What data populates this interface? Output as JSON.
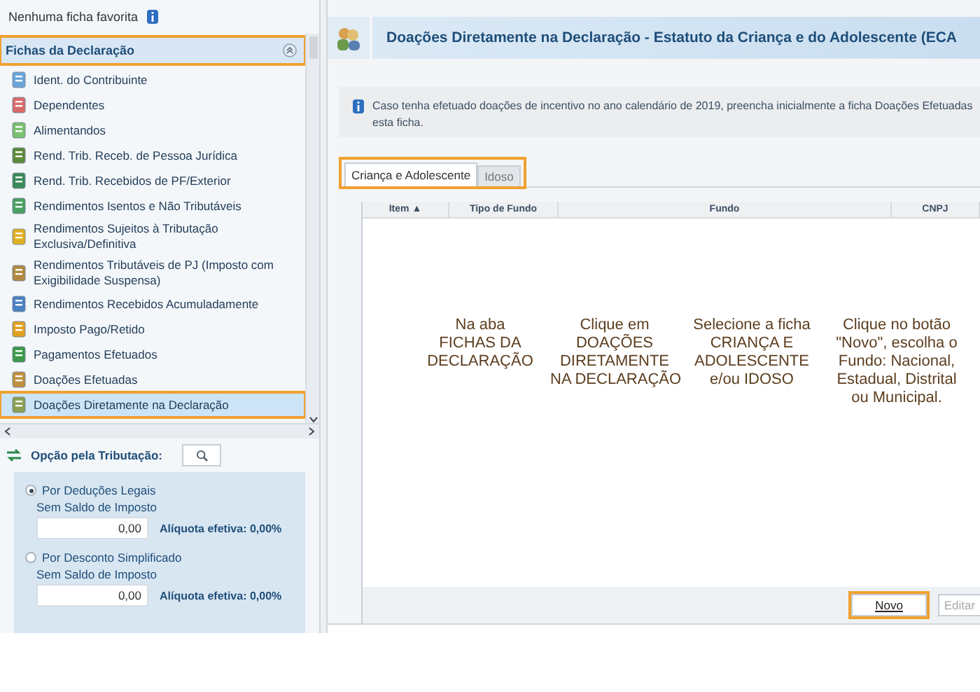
{
  "favorites": {
    "text": "Nenhuma ficha favorita"
  },
  "sidebar": {
    "section": {
      "title": "Fichas da Declaração",
      "expanded": true,
      "highlighted": true
    },
    "items": [
      {
        "label": "Ident. do Contribuinte",
        "selected": false,
        "highlighted": false
      },
      {
        "label": "Dependentes",
        "selected": false,
        "highlighted": false
      },
      {
        "label": "Alimentandos",
        "selected": false,
        "highlighted": false
      },
      {
        "label": "Rend. Trib. Receb. de Pessoa Jurídica",
        "selected": false,
        "highlighted": false
      },
      {
        "label": "Rend. Trib. Recebidos de PF/Exterior",
        "selected": false,
        "highlighted": false
      },
      {
        "label": "Rendimentos Isentos e Não Tributáveis",
        "selected": false,
        "highlighted": false
      },
      {
        "label": "Rendimentos Sujeitos à Tributação Exclusiva/Definitiva",
        "selected": false,
        "highlighted": false
      },
      {
        "label": "Rendimentos Tributáveis de PJ (Imposto com Exigibilidade Suspensa)",
        "selected": false,
        "highlighted": false
      },
      {
        "label": "Rendimentos Recebidos Acumuladamente",
        "selected": false,
        "highlighted": false
      },
      {
        "label": "Imposto Pago/Retido",
        "selected": false,
        "highlighted": false
      },
      {
        "label": "Pagamentos Efetuados",
        "selected": false,
        "highlighted": false
      },
      {
        "label": "Doações Efetuadas",
        "selected": false,
        "highlighted": false
      },
      {
        "label": "Doações Diretamente na Declaração",
        "selected": true,
        "highlighted": true
      }
    ]
  },
  "taxation": {
    "title": "Opção pela Tributação:",
    "options": [
      {
        "label": "Por Deduções Legais",
        "selected": true,
        "caption": "Sem Saldo de Imposto",
        "value": "0,00",
        "rate": "Alíquota efetiva: 0,00%"
      },
      {
        "label": "Por Desconto Simplificado",
        "selected": false,
        "caption": "Sem Saldo de Imposto",
        "value": "0,00",
        "rate": "Alíquota efetiva: 0,00%"
      }
    ]
  },
  "header": {
    "title": "Doações Diretamente na Declaração - Estatuto da Criança e do Adolescente (ECA"
  },
  "info": {
    "lines": [
      "Caso tenha efetuado doações de incentivo no ano calendário de 2019, preencha inicialmente a ficha Doações Efetuadas",
      "esta ficha."
    ]
  },
  "tabs": {
    "highlighted": true,
    "items": [
      {
        "label": "Criança e Adolescente",
        "selected": true
      },
      {
        "label": "Idoso",
        "selected": false
      }
    ]
  },
  "table": {
    "columns": [
      {
        "label": "Item ▲"
      },
      {
        "label": "Tipo de Fundo"
      },
      {
        "label": "Fundo"
      },
      {
        "label": "CNPJ"
      }
    ]
  },
  "notes": [
    "Na aba\nFICHAS DA\nDECLARAÇÃO",
    "Clique em\nDOAÇÕES\nDIRETAMENTE\nNA DECLARAÇÃO",
    "Selecione a ficha\nCRIANÇA E\nADOLESCENTE\ne/ou IDOSO",
    "Clique no botão\n\"Novo\", escolha o\nFundo: Nacional,\nEstadual, Distrital\nou Municipal."
  ],
  "buttons": [
    {
      "label": "Novo",
      "disabled": false,
      "highlighted": true
    },
    {
      "label": "Editar",
      "disabled": true,
      "highlighted": false
    }
  ]
}
